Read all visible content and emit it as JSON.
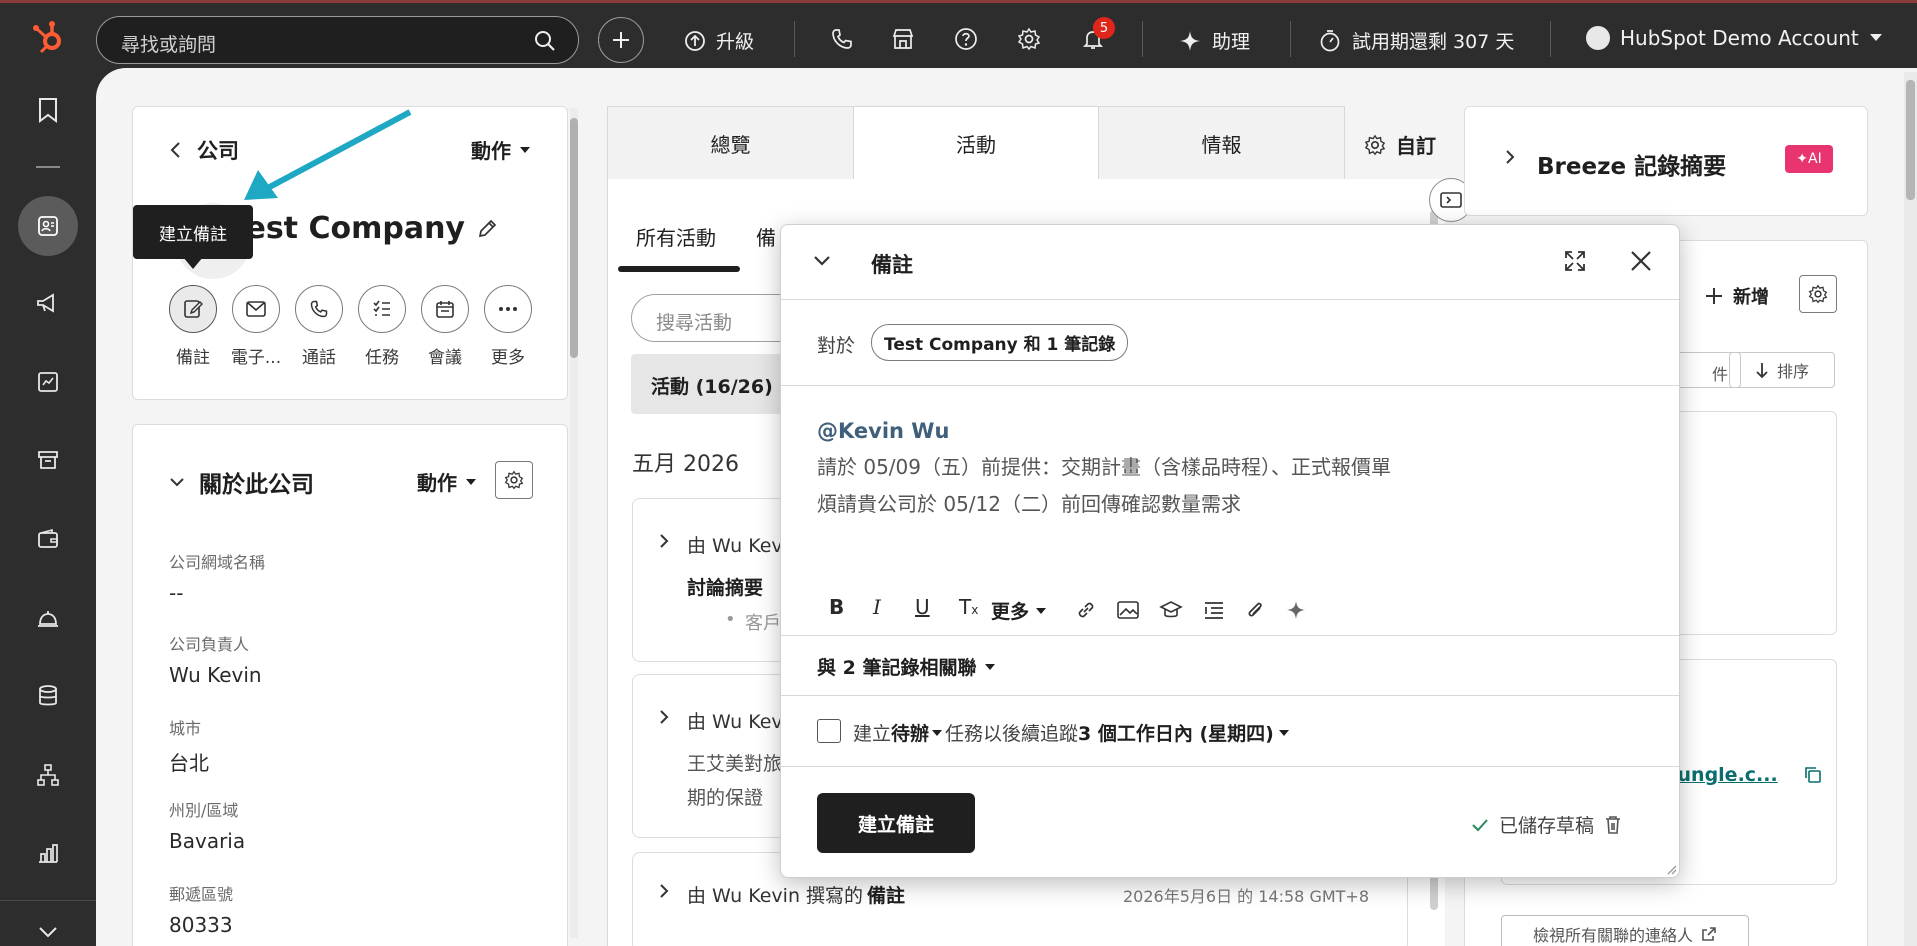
{
  "topbar": {
    "search_placeholder": "尋找或詢問",
    "upgrade_label": "升級",
    "notification_count": "5",
    "assistant_label": "助理",
    "trial_label": "試用期還剩 307 天",
    "account_label": "HubSpot Demo Account"
  },
  "sidebar": {
    "icons": [
      "bookmark-icon",
      "contacts-icon",
      "marketing-icon",
      "reports-icon",
      "commerce-icon",
      "wallet-icon",
      "service-icon",
      "database-icon",
      "org-icon",
      "analytics-icon",
      "expand-icon"
    ]
  },
  "left_panel": {
    "back_label": "公司",
    "actions_label": "動作",
    "company_name": "Test Company",
    "tooltip": "建立備註",
    "actions": [
      {
        "label": "備註",
        "icon": "note-icon"
      },
      {
        "label": "電子...",
        "icon": "email-icon"
      },
      {
        "label": "通話",
        "icon": "phone-icon"
      },
      {
        "label": "任務",
        "icon": "task-icon"
      },
      {
        "label": "會議",
        "icon": "meeting-icon"
      },
      {
        "label": "更多",
        "icon": "more-icon"
      }
    ],
    "about": {
      "title": "關於此公司",
      "actions_label": "動作",
      "fields": [
        {
          "label": "公司網域名稱",
          "value": "--"
        },
        {
          "label": "公司負責人",
          "value": "Wu Kevin"
        },
        {
          "label": "城市",
          "value": "台北"
        },
        {
          "label": "州別/區域",
          "value": "Bavaria"
        },
        {
          "label": "郵遞區號",
          "value": "80333"
        }
      ]
    }
  },
  "center": {
    "tabs": [
      "總覽",
      "活動",
      "情報"
    ],
    "customize_label": "自訂",
    "subtab_all": "所有活動",
    "subtab_partial": "備",
    "search_placeholder": "搜尋活動",
    "activity_count": "活動 (16/26)",
    "month": "五月 2026",
    "feed": [
      {
        "author": "由 Wu Kev",
        "title": "討論摘要",
        "bullet": "客戶"
      },
      {
        "author": "由 Wu Kev",
        "line1": "王艾美對旅",
        "line2": "期的保證"
      },
      {
        "author_prefix": "由 Wu Kevin 撰寫的",
        "author_bold": "備註",
        "timestamp": "2026年5月6日 的 14:58 GMT+8"
      }
    ]
  },
  "note_modal": {
    "title": "備註",
    "for_label": "對於",
    "for_pill": "Test Company 和 1 筆記錄",
    "mention": "@Kevin Wu",
    "body_line1": "請於 05/09（五）前提供：交期計畫（含樣品時程）、正式報價單",
    "body_line2": "煩請貴公司於 05/12（二）前回傳確認數量需求",
    "more_label": "更多",
    "associations_label": "與 2 筆記錄相關聯",
    "followup_prefix": "建立",
    "followup_type": "待辦",
    "followup_middle": "任務以後續追蹤",
    "followup_due": "3 個工作日內 (星期四)",
    "create_button": "建立備註",
    "saved_label": "已儲存草稿"
  },
  "right_panel": {
    "breeze_title": "Breeze 記錄摘要",
    "ai_badge": "✦AI",
    "add_label": "新增",
    "filter_partial": "件",
    "sort_label": "排序",
    "email_partial": "@jungle.c...",
    "view_all_label": "檢視所有關聯的連絡人"
  },
  "colors": {
    "hubspot_orange": "#ff5c35",
    "arrow_teal": "#1fa8c4",
    "ai_pink": "#e8346f",
    "badge_red": "#e0251b"
  }
}
